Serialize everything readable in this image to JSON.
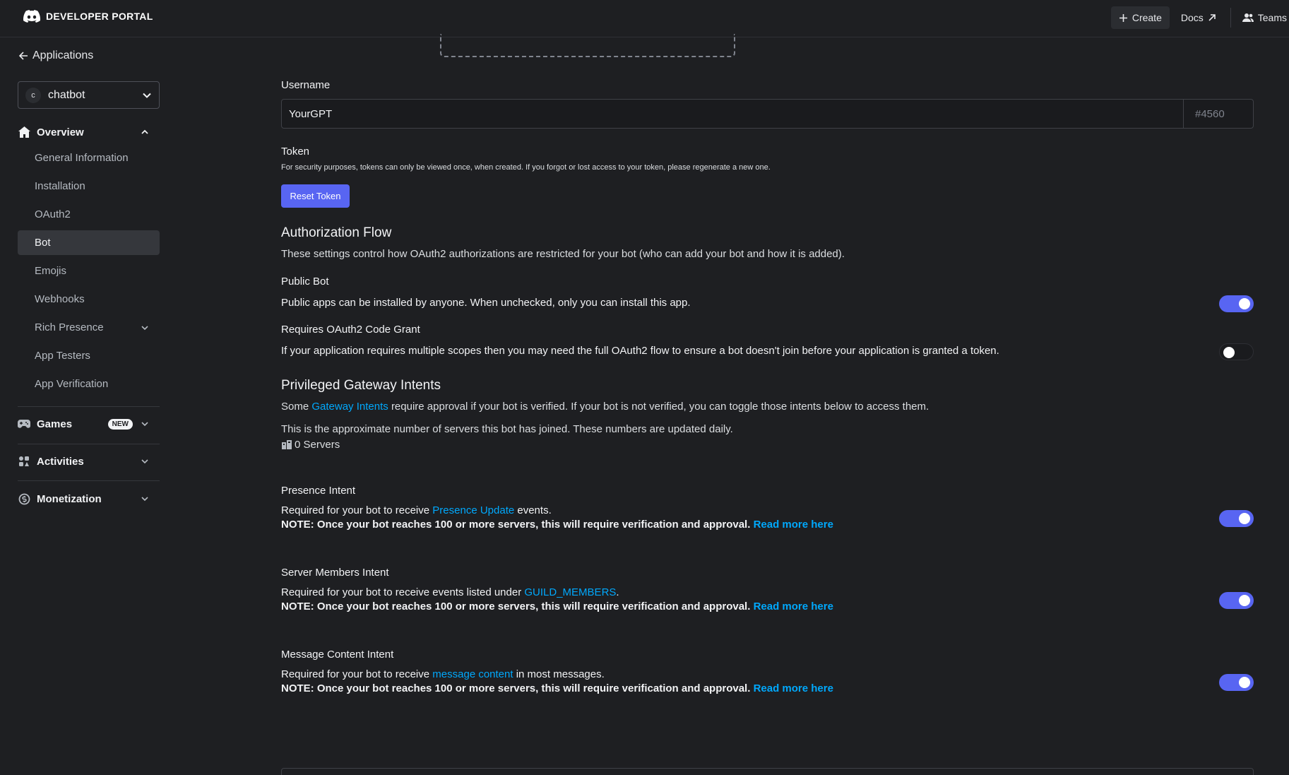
{
  "topbar": {
    "brand": "DEVELOPER PORTAL",
    "create_label": "Create",
    "docs_label": "Docs",
    "teams_label": "Teams"
  },
  "sidebar": {
    "back_label": "Applications",
    "app": {
      "initial": "c",
      "name": "chatbot"
    },
    "overview_label": "Overview",
    "items": [
      {
        "label": "General Information"
      },
      {
        "label": "Installation"
      },
      {
        "label": "OAuth2"
      },
      {
        "label": "Bot"
      },
      {
        "label": "Emojis"
      },
      {
        "label": "Webhooks"
      },
      {
        "label": "Rich Presence"
      },
      {
        "label": "App Testers"
      },
      {
        "label": "App Verification"
      }
    ],
    "games_label": "Games",
    "games_badge": "NEW",
    "activities_label": "Activities",
    "monetization_label": "Monetization"
  },
  "main": {
    "username_label": "Username",
    "username_value": "YourGPT",
    "discriminator": "#4560",
    "token_label": "Token",
    "token_help": "For security purposes, tokens can only be viewed once, when created. If you forgot or lost access to your token, please regenerate a new one.",
    "reset_token_label": "Reset Token",
    "auth_flow": {
      "title": "Authorization Flow",
      "description": "These settings control how OAuth2 authorizations are restricted for your bot (who can add your bot and how it is added).",
      "public_bot_label": "Public Bot",
      "public_bot_desc": "Public apps can be installed by anyone. When unchecked, only you can install this app.",
      "public_bot_on": true,
      "code_grant_label": "Requires OAuth2 Code Grant",
      "code_grant_desc": "If your application requires multiple scopes then you may need the full OAuth2 flow to ensure a bot doesn't join before your application is granted a token.",
      "code_grant_on": false
    },
    "intents": {
      "title": "Privileged Gateway Intents",
      "desc_before": "Some",
      "desc_link": "Gateway Intents",
      "desc_after": "require approval if your bot is verified. If your bot is not verified, you can toggle those intents below to access them.",
      "servers_note": "This is the approximate number of servers this bot has joined. These numbers are updated daily.",
      "servers_count": "0 Servers",
      "note_text": "NOTE: Once your bot reaches 100 or more servers, this will require verification and approval.",
      "read_more": "Read more here",
      "presence": {
        "label": "Presence Intent",
        "desc_before": "Required for your bot to receive",
        "desc_link": "Presence Update",
        "desc_after": "events.",
        "on": true
      },
      "members": {
        "label": "Server Members Intent",
        "desc_before": "Required for your bot to receive events listed under",
        "desc_link": "GUILD_MEMBERS",
        "desc_after": ".",
        "on": true
      },
      "message": {
        "label": "Message Content Intent",
        "desc_before": "Required for your bot to receive",
        "desc_link": "message content",
        "desc_after": "in most messages.",
        "on": true
      }
    }
  }
}
